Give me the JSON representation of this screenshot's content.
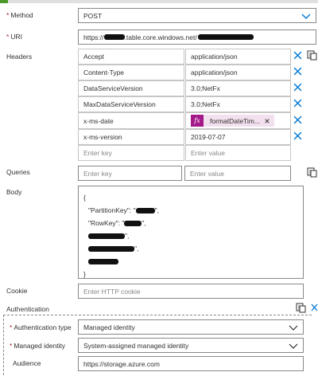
{
  "method": {
    "label": "Method",
    "value": "POST"
  },
  "uri": {
    "label": "URI",
    "prefix": "https://",
    "middle": ".table.core.windows.net/"
  },
  "headers": {
    "label": "Headers",
    "rows": [
      {
        "key": "Accept",
        "value": "application/json"
      },
      {
        "key": "Content-Type",
        "value": "application/json"
      },
      {
        "key": "DataServiceVersion",
        "value": "3.0;NetFx"
      },
      {
        "key": "MaxDataServiceVersion",
        "value": "3.0;NetFx"
      },
      {
        "key": "x-ms-date",
        "value": "formatDateTim..."
      },
      {
        "key": "x-ms-version",
        "value": "2019-07-07"
      }
    ],
    "fx_label": "fx",
    "key_placeholder": "Enter key",
    "value_placeholder": "Enter value"
  },
  "queries": {
    "label": "Queries",
    "key_placeholder": "Enter key",
    "value_placeholder": "Enter value"
  },
  "body": {
    "label": "Body",
    "open_brace": "{",
    "partition_key_label": "\"PartitionKey\": \"",
    "partition_key_suffix": "\",",
    "row_key_label": "\"RowKey\": \"",
    "row_key_suffix": "\",",
    "line_suffix_3": "\",",
    "line_suffix_4": "\",",
    "close_brace": "}"
  },
  "cookie": {
    "label": "Cookie",
    "placeholder": "Enter HTTP cookie"
  },
  "authentication": {
    "label": "Authentication",
    "type_label": "Authentication type",
    "type_value": "Managed identity",
    "identity_label": "Managed identity",
    "identity_value": "System-assigned managed identity",
    "audience_label": "Audience",
    "audience_value": "https://storage.azure.com"
  },
  "colors": {
    "accent": "#0078d4",
    "required": "#a4262c",
    "fx": "#a4198a",
    "token_bg": "#f3e0ef"
  }
}
